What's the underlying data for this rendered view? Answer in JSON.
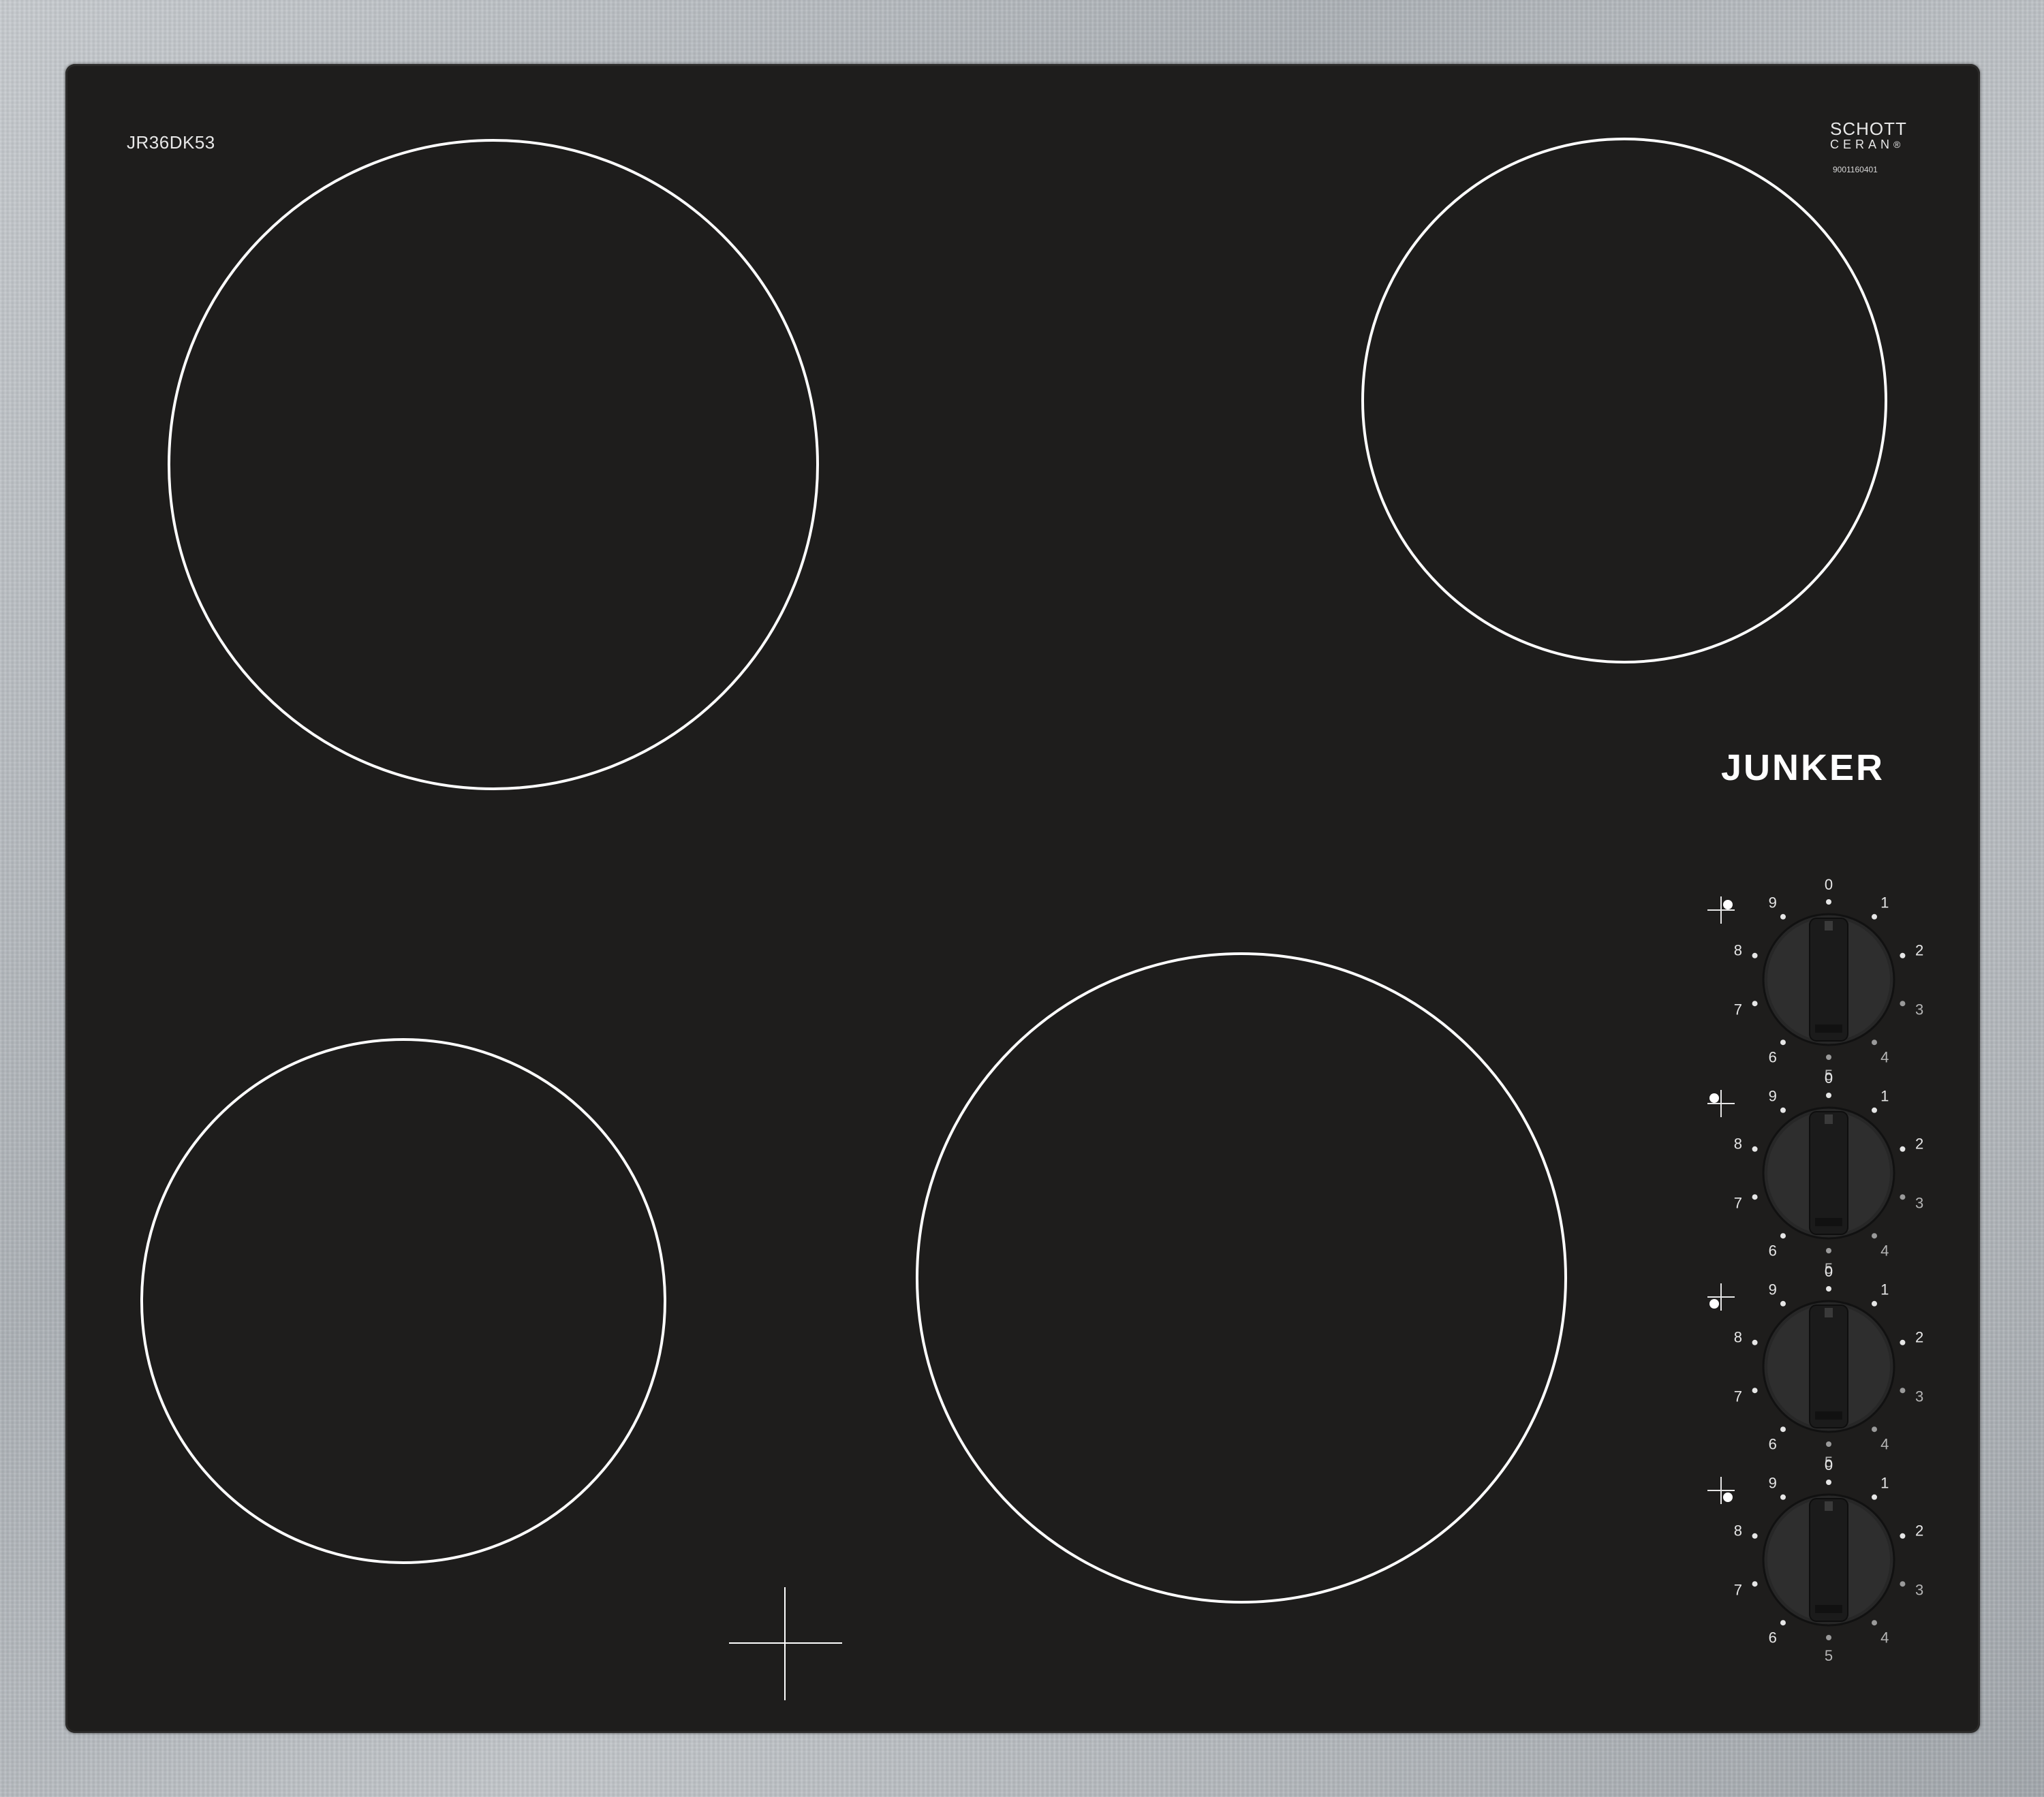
{
  "hob": {
    "model_label": "JR36DK53",
    "glass_brand_top": "SCHOTT",
    "glass_brand_bottom": "CERAN",
    "glass_brand_reg": "®",
    "serial": "9001160401",
    "brand_logo": "JUNKER"
  },
  "colors": {
    "glass": "#1e1d1c",
    "frame": "#b9bdc1",
    "ring": "#ffffff",
    "knob": "#2a2a2a"
  },
  "knobs": [
    {
      "zone": "rear-right",
      "scale": [
        "0",
        "1",
        "2",
        "3",
        "4",
        "5",
        "6",
        "7",
        "8",
        "9"
      ]
    },
    {
      "zone": "rear-left",
      "scale": [
        "0",
        "1",
        "2",
        "3",
        "4",
        "5",
        "6",
        "7",
        "8",
        "9"
      ]
    },
    {
      "zone": "front-left",
      "scale": [
        "0",
        "1",
        "2",
        "3",
        "4",
        "5",
        "6",
        "7",
        "8",
        "9"
      ]
    },
    {
      "zone": "front-right",
      "scale": [
        "0",
        "1",
        "2",
        "3",
        "4",
        "5",
        "6",
        "7",
        "8",
        "9"
      ]
    }
  ]
}
